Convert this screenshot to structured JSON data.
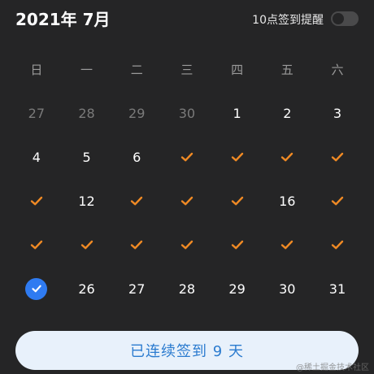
{
  "header": {
    "title": "2021年 7月",
    "reminder_label": "10点签到提醒",
    "reminder_enabled": false
  },
  "weekdays": [
    "日",
    "一",
    "二",
    "三",
    "四",
    "五",
    "六"
  ],
  "days": [
    {
      "label": "27",
      "state": "muted"
    },
    {
      "label": "28",
      "state": "muted"
    },
    {
      "label": "29",
      "state": "muted"
    },
    {
      "label": "30",
      "state": "muted"
    },
    {
      "label": "1",
      "state": "normal"
    },
    {
      "label": "2",
      "state": "normal"
    },
    {
      "label": "3",
      "state": "normal"
    },
    {
      "label": "4",
      "state": "normal"
    },
    {
      "label": "5",
      "state": "normal"
    },
    {
      "label": "6",
      "state": "normal"
    },
    {
      "label": "",
      "state": "checked"
    },
    {
      "label": "",
      "state": "checked"
    },
    {
      "label": "",
      "state": "checked"
    },
    {
      "label": "",
      "state": "checked"
    },
    {
      "label": "",
      "state": "checked"
    },
    {
      "label": "12",
      "state": "normal"
    },
    {
      "label": "",
      "state": "checked"
    },
    {
      "label": "",
      "state": "checked"
    },
    {
      "label": "",
      "state": "checked"
    },
    {
      "label": "16",
      "state": "normal"
    },
    {
      "label": "",
      "state": "checked"
    },
    {
      "label": "",
      "state": "checked"
    },
    {
      "label": "",
      "state": "checked"
    },
    {
      "label": "",
      "state": "checked"
    },
    {
      "label": "",
      "state": "checked"
    },
    {
      "label": "",
      "state": "checked"
    },
    {
      "label": "",
      "state": "checked"
    },
    {
      "label": "",
      "state": "checked"
    },
    {
      "label": "",
      "state": "today-checked"
    },
    {
      "label": "26",
      "state": "normal"
    },
    {
      "label": "27",
      "state": "normal"
    },
    {
      "label": "28",
      "state": "normal"
    },
    {
      "label": "29",
      "state": "normal"
    },
    {
      "label": "30",
      "state": "normal"
    },
    {
      "label": "31",
      "state": "normal"
    }
  ],
  "streak_button": {
    "label": "已连续签到  9  天"
  },
  "watermark": "@稀土掘金技术社区",
  "colors": {
    "background": "#252526",
    "check": "#f08a24",
    "today": "#2f7bf1",
    "button_bg": "#e8f1fb",
    "button_text": "#2b7bcf"
  },
  "icons": {
    "checked_day": "checkmark-icon",
    "today": "check-circle-icon"
  }
}
